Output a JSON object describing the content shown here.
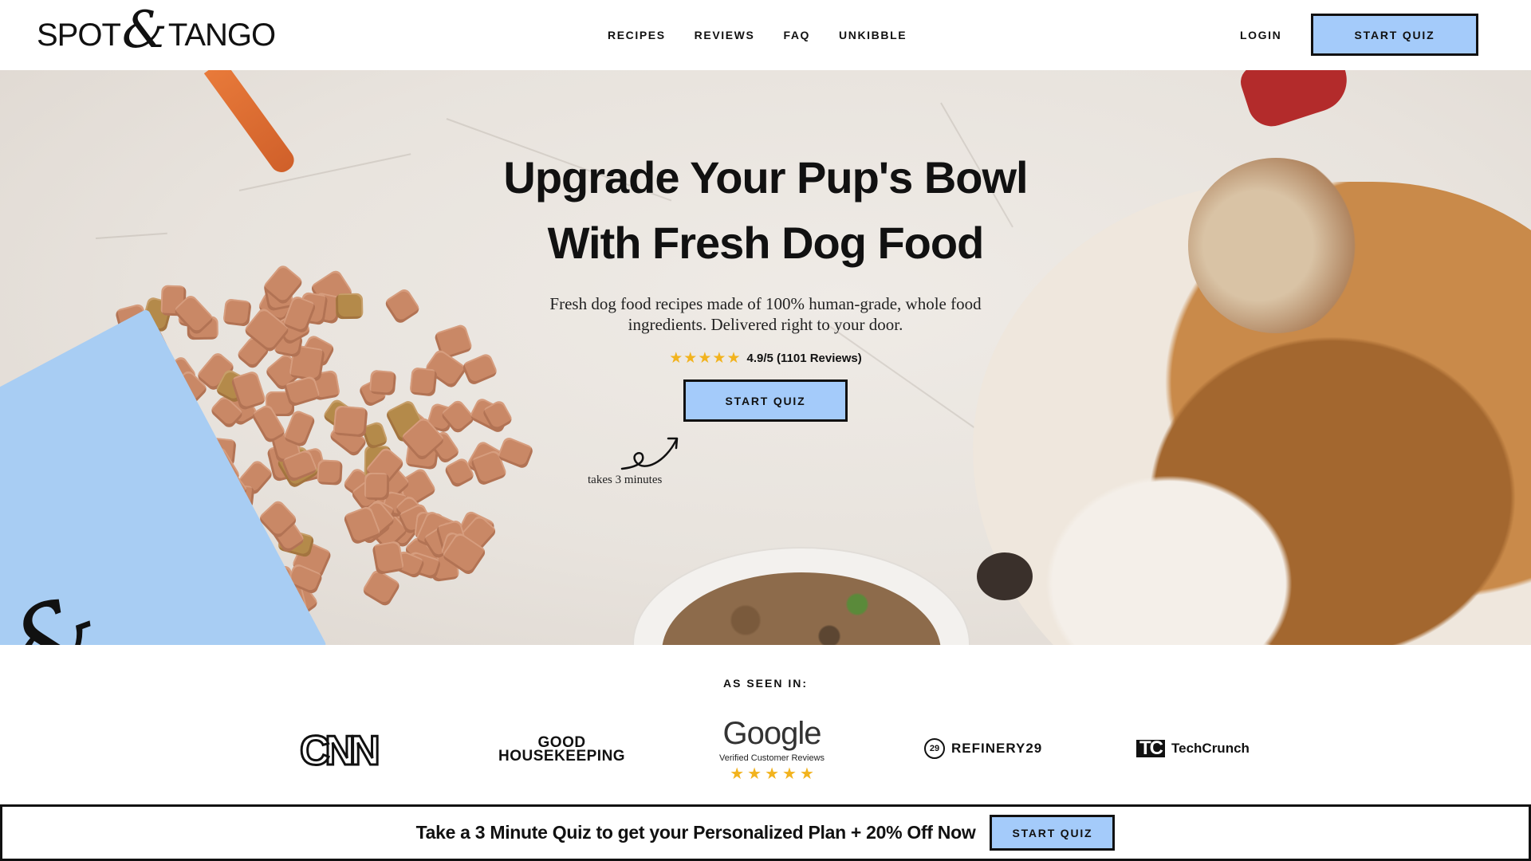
{
  "header": {
    "logo_left": "SPOT",
    "logo_amp": "&",
    "logo_right": "TANGO",
    "nav": [
      "RECIPES",
      "REVIEWS",
      "FAQ",
      "UNKIBBLE"
    ],
    "login_label": "LOGIN",
    "cta_label": "START QUIZ"
  },
  "hero": {
    "title_line1": "Upgrade Your Pup's Bowl",
    "title_line2": "With Fresh Dog Food",
    "subtitle": "Fresh dog food recipes made of 100% human-grade, whole food ingredients. Delivered right to your door.",
    "rating_text": "4.9/5 (1101 Reviews)",
    "rating_stars": 5,
    "cta_label": "START QUIZ",
    "takes_note": "takes 3 minutes"
  },
  "press": {
    "label": "AS SEEN IN:",
    "cnn": "CNN",
    "gh_line1": "GOOD",
    "gh_line2": "HOUSEKEEPING",
    "google_word": "Google",
    "google_sub": "Verified Customer Reviews",
    "refinery_mark": "29",
    "refinery": "REFINERY29",
    "techcrunch_mark": "TC",
    "techcrunch": "TechCrunch"
  },
  "banner": {
    "text": "Take a 3 Minute Quiz to get your Personalized Plan + 20% Off Now",
    "cta_label": "START QUIZ"
  },
  "colors": {
    "accent_blue": "#a4cbfa",
    "star_gold": "#f2b31e",
    "text": "#111111"
  }
}
